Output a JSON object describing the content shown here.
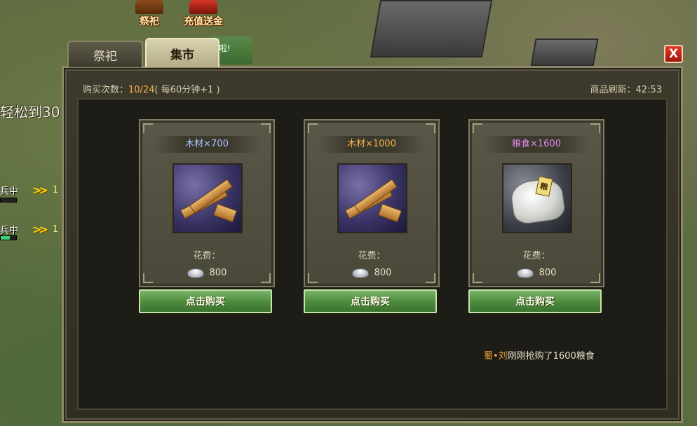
{
  "top_icons": [
    {
      "label": "祭祀"
    },
    {
      "label": "充值送金"
    }
  ],
  "left_side": {
    "headline": "轻松到30",
    "rows": [
      {
        "tag": "兵中",
        "arrows": ">>",
        "num": "1"
      },
      {
        "tag": "兵中",
        "arrows": ">>",
        "num": "1"
      }
    ]
  },
  "tabs": [
    {
      "label": "祭祀",
      "active": false
    },
    {
      "label": "集市",
      "active": true
    }
  ],
  "behind_tab_text": "啦!",
  "close_label": "X",
  "header": {
    "buy_count_prefix": "购买次数：",
    "buy_count": "10/24",
    "buy_count_suffix": "( 每60分钟+1 )",
    "refresh_label": "商品刷新：42:53"
  },
  "items": [
    {
      "title": "木材×700",
      "title_color": "#a9c6ff",
      "icon": "wood-icon",
      "cost_label": "花费：",
      "price": "800",
      "currency_icon": "silver-icon",
      "buy_label": "点击购买"
    },
    {
      "title": "木材×1000",
      "title_color": "#f2b64c",
      "icon": "wood-icon",
      "cost_label": "花费：",
      "price": "800",
      "currency_icon": "silver-icon",
      "buy_label": "点击购买"
    },
    {
      "title": "粮食×1600",
      "title_color": "#e08cf2",
      "icon": "grain-sack-icon",
      "cost_label": "花费：",
      "price": "800",
      "currency_icon": "silver-icon",
      "buy_label": "点击购买"
    }
  ],
  "grain_tag": "粮",
  "notice": {
    "who": "蜀•刘",
    "text": "刚刚抢购了1600粮食"
  }
}
